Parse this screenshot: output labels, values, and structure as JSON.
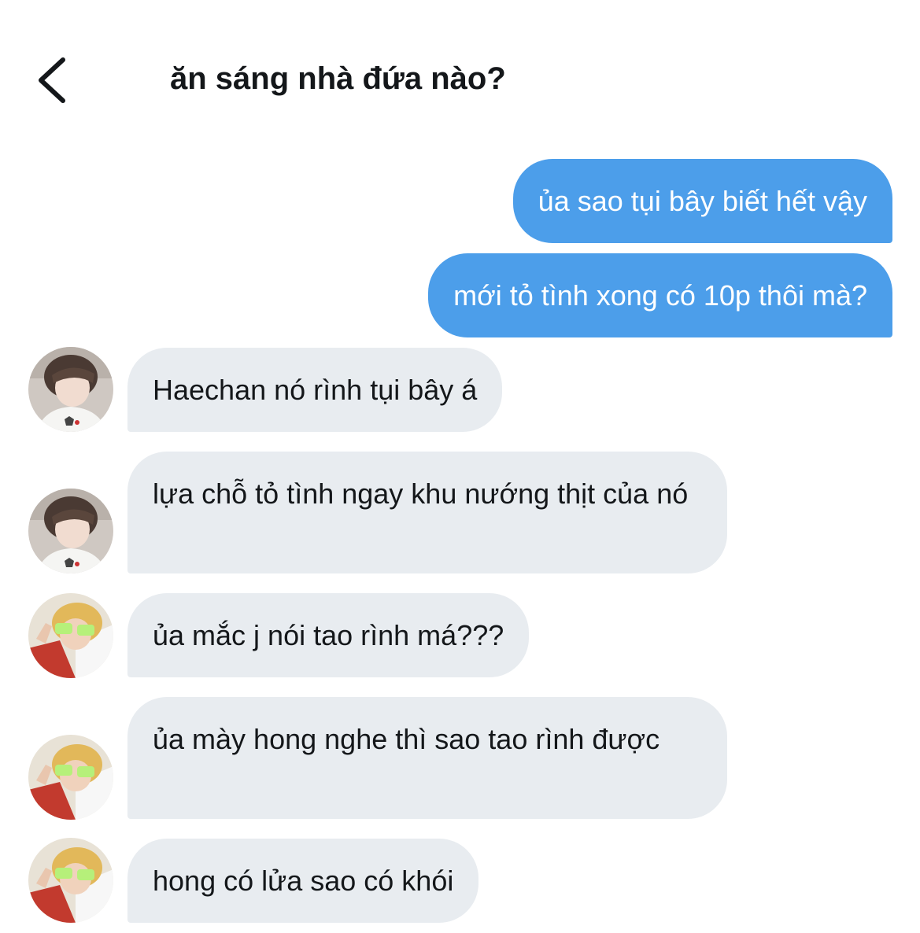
{
  "header": {
    "back_icon": "chevron-left-icon",
    "title": "ăn sáng nhà đứa nào?"
  },
  "colors": {
    "sent_bubble": "#4c9eea",
    "received_bubble": "#e8ecf0",
    "text": "#14171a"
  },
  "messages": [
    {
      "direction": "sent",
      "text": "ủa sao tụi bây biết hết vậy"
    },
    {
      "direction": "sent",
      "text": "mới tỏ tình xong có 10p thôi mà?"
    },
    {
      "direction": "received",
      "sender_avatar": "avatar-a",
      "text": "Haechan nó rình tụi bây á"
    },
    {
      "direction": "received",
      "sender_avatar": "avatar-a",
      "text": "lựa chỗ tỏ tình ngay khu nướng thịt của nó"
    },
    {
      "direction": "received",
      "sender_avatar": "avatar-b",
      "text": "ủa mắc j nói tao rình má???"
    },
    {
      "direction": "received",
      "sender_avatar": "avatar-b",
      "text": "ủa mày hong nghe thì sao tao rình được"
    },
    {
      "direction": "received",
      "sender_avatar": "avatar-b",
      "text": "hong có lửa sao có khói"
    }
  ]
}
